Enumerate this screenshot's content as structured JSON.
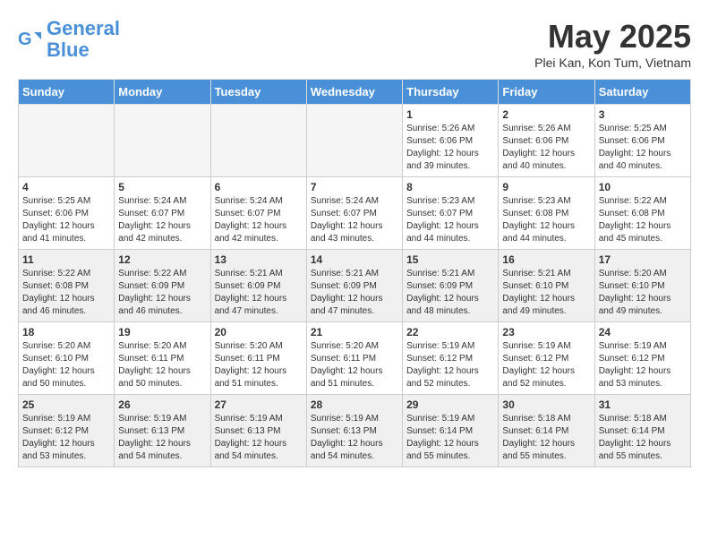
{
  "header": {
    "logo_line1": "General",
    "logo_line2": "Blue",
    "month": "May 2025",
    "location": "Plei Kan, Kon Tum, Vietnam"
  },
  "days_of_week": [
    "Sunday",
    "Monday",
    "Tuesday",
    "Wednesday",
    "Thursday",
    "Friday",
    "Saturday"
  ],
  "weeks": [
    [
      {
        "day": "",
        "empty": true
      },
      {
        "day": "",
        "empty": true
      },
      {
        "day": "",
        "empty": true
      },
      {
        "day": "",
        "empty": true
      },
      {
        "day": "1",
        "sunrise": "5:26 AM",
        "sunset": "6:06 PM",
        "daylight": "12 hours and 39 minutes."
      },
      {
        "day": "2",
        "sunrise": "5:26 AM",
        "sunset": "6:06 PM",
        "daylight": "12 hours and 40 minutes."
      },
      {
        "day": "3",
        "sunrise": "5:25 AM",
        "sunset": "6:06 PM",
        "daylight": "12 hours and 40 minutes."
      }
    ],
    [
      {
        "day": "4",
        "sunrise": "5:25 AM",
        "sunset": "6:06 PM",
        "daylight": "12 hours and 41 minutes."
      },
      {
        "day": "5",
        "sunrise": "5:24 AM",
        "sunset": "6:07 PM",
        "daylight": "12 hours and 42 minutes."
      },
      {
        "day": "6",
        "sunrise": "5:24 AM",
        "sunset": "6:07 PM",
        "daylight": "12 hours and 42 minutes."
      },
      {
        "day": "7",
        "sunrise": "5:24 AM",
        "sunset": "6:07 PM",
        "daylight": "12 hours and 43 minutes."
      },
      {
        "day": "8",
        "sunrise": "5:23 AM",
        "sunset": "6:07 PM",
        "daylight": "12 hours and 44 minutes."
      },
      {
        "day": "9",
        "sunrise": "5:23 AM",
        "sunset": "6:08 PM",
        "daylight": "12 hours and 44 minutes."
      },
      {
        "day": "10",
        "sunrise": "5:22 AM",
        "sunset": "6:08 PM",
        "daylight": "12 hours and 45 minutes."
      }
    ],
    [
      {
        "day": "11",
        "sunrise": "5:22 AM",
        "sunset": "6:08 PM",
        "daylight": "12 hours and 46 minutes."
      },
      {
        "day": "12",
        "sunrise": "5:22 AM",
        "sunset": "6:09 PM",
        "daylight": "12 hours and 46 minutes."
      },
      {
        "day": "13",
        "sunrise": "5:21 AM",
        "sunset": "6:09 PM",
        "daylight": "12 hours and 47 minutes."
      },
      {
        "day": "14",
        "sunrise": "5:21 AM",
        "sunset": "6:09 PM",
        "daylight": "12 hours and 47 minutes."
      },
      {
        "day": "15",
        "sunrise": "5:21 AM",
        "sunset": "6:09 PM",
        "daylight": "12 hours and 48 minutes."
      },
      {
        "day": "16",
        "sunrise": "5:21 AM",
        "sunset": "6:10 PM",
        "daylight": "12 hours and 49 minutes."
      },
      {
        "day": "17",
        "sunrise": "5:20 AM",
        "sunset": "6:10 PM",
        "daylight": "12 hours and 49 minutes."
      }
    ],
    [
      {
        "day": "18",
        "sunrise": "5:20 AM",
        "sunset": "6:10 PM",
        "daylight": "12 hours and 50 minutes."
      },
      {
        "day": "19",
        "sunrise": "5:20 AM",
        "sunset": "6:11 PM",
        "daylight": "12 hours and 50 minutes."
      },
      {
        "day": "20",
        "sunrise": "5:20 AM",
        "sunset": "6:11 PM",
        "daylight": "12 hours and 51 minutes."
      },
      {
        "day": "21",
        "sunrise": "5:20 AM",
        "sunset": "6:11 PM",
        "daylight": "12 hours and 51 minutes."
      },
      {
        "day": "22",
        "sunrise": "5:19 AM",
        "sunset": "6:12 PM",
        "daylight": "12 hours and 52 minutes."
      },
      {
        "day": "23",
        "sunrise": "5:19 AM",
        "sunset": "6:12 PM",
        "daylight": "12 hours and 52 minutes."
      },
      {
        "day": "24",
        "sunrise": "5:19 AM",
        "sunset": "6:12 PM",
        "daylight": "12 hours and 53 minutes."
      }
    ],
    [
      {
        "day": "25",
        "sunrise": "5:19 AM",
        "sunset": "6:12 PM",
        "daylight": "12 hours and 53 minutes."
      },
      {
        "day": "26",
        "sunrise": "5:19 AM",
        "sunset": "6:13 PM",
        "daylight": "12 hours and 54 minutes."
      },
      {
        "day": "27",
        "sunrise": "5:19 AM",
        "sunset": "6:13 PM",
        "daylight": "12 hours and 54 minutes."
      },
      {
        "day": "28",
        "sunrise": "5:19 AM",
        "sunset": "6:13 PM",
        "daylight": "12 hours and 54 minutes."
      },
      {
        "day": "29",
        "sunrise": "5:19 AM",
        "sunset": "6:14 PM",
        "daylight": "12 hours and 55 minutes."
      },
      {
        "day": "30",
        "sunrise": "5:18 AM",
        "sunset": "6:14 PM",
        "daylight": "12 hours and 55 minutes."
      },
      {
        "day": "31",
        "sunrise": "5:18 AM",
        "sunset": "6:14 PM",
        "daylight": "12 hours and 55 minutes."
      }
    ]
  ]
}
